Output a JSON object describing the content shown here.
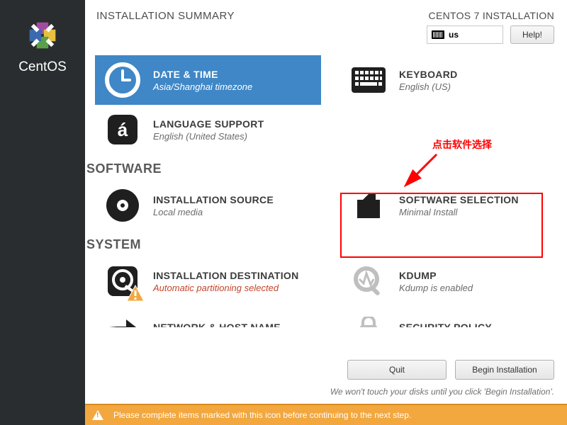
{
  "brand": "CentOS",
  "page_title": "INSTALLATION SUMMARY",
  "install_label": "CENTOS 7 INSTALLATION",
  "keyboard_indicator": "us",
  "help_label": "Help!",
  "sections": {
    "localization": {
      "datetime": {
        "title": "DATE & TIME",
        "sub": "Asia/Shanghai timezone"
      },
      "keyboard": {
        "title": "KEYBOARD",
        "sub": "English (US)"
      },
      "language": {
        "title": "LANGUAGE SUPPORT",
        "sub": "English (United States)"
      }
    },
    "software_head": "SOFTWARE",
    "software": {
      "source": {
        "title": "INSTALLATION SOURCE",
        "sub": "Local media"
      },
      "selection": {
        "title": "SOFTWARE SELECTION",
        "sub": "Minimal Install"
      }
    },
    "system_head": "SYSTEM",
    "system": {
      "destination": {
        "title": "INSTALLATION DESTINATION",
        "sub": "Automatic partitioning selected"
      },
      "kdump": {
        "title": "KDUMP",
        "sub": "Kdump is enabled"
      },
      "network": {
        "title": "NETWORK & HOST NAME"
      },
      "security": {
        "title": "SECURITY POLICY"
      }
    }
  },
  "annotation": "点击软件选择",
  "buttons": {
    "quit": "Quit",
    "begin": "Begin Installation"
  },
  "footer_note": "We won't touch your disks until you click 'Begin Installation'.",
  "warning_bar": "Please complete items marked with this icon before continuing to the next step."
}
